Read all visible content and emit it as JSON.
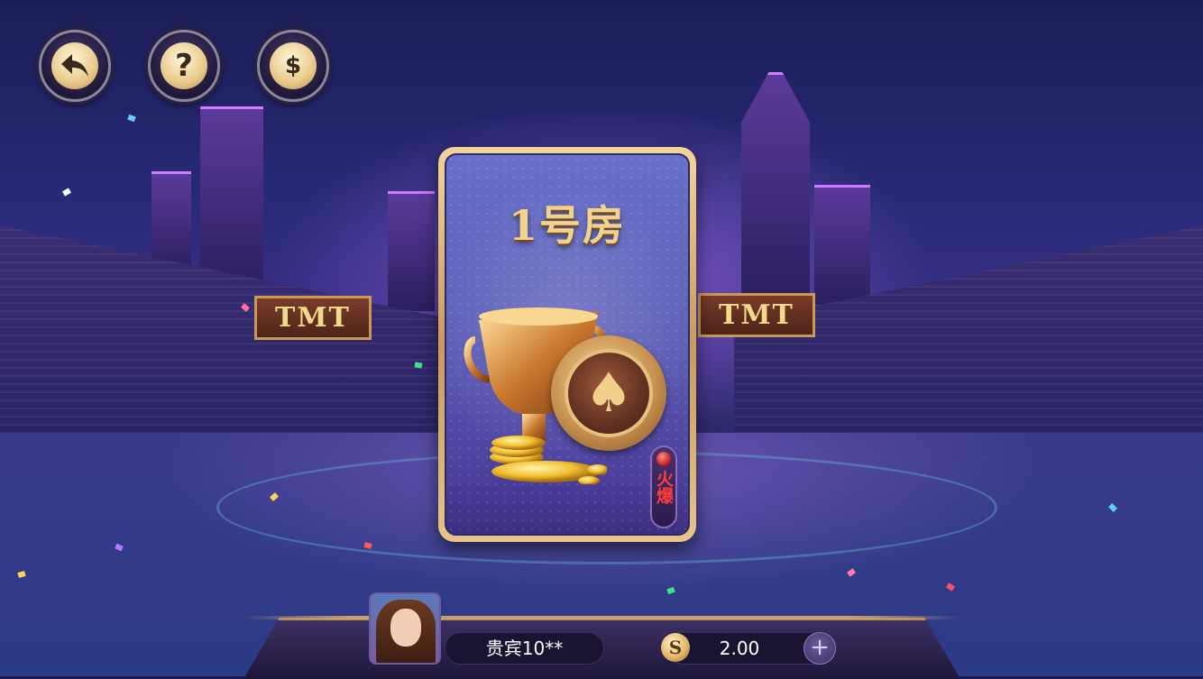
{
  "top_buttons": {
    "back_icon": "back-arrow-icon",
    "help_label": "?",
    "coin_label": "$"
  },
  "room_card": {
    "title": "1号房",
    "hot_label": "火爆",
    "image_icon": "trophy-and-spade-chip-icon"
  },
  "player": {
    "name": "贵宾10**",
    "balance": "2.00",
    "coin_icon_label": "S",
    "add_label": "+"
  },
  "signs": {
    "left": "TMT",
    "right": "TMT"
  },
  "colors": {
    "accent_gold": "#f2d38e",
    "hot_red": "#ff3b3b",
    "bar_bg": "#1a1332"
  }
}
